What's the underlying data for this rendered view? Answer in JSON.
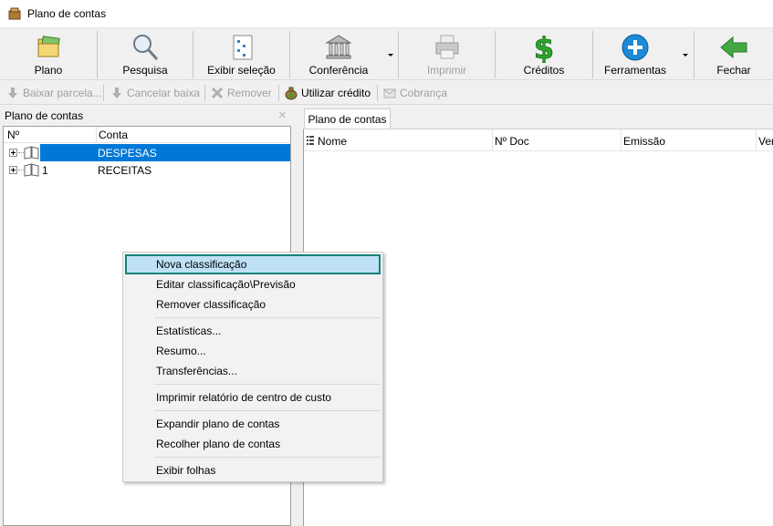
{
  "window": {
    "title": "Plano de contas"
  },
  "toolbar": {
    "buttons": [
      {
        "label": "Plano",
        "icon": "folder-icon",
        "enabled": true
      },
      {
        "label": "Pesquisa",
        "icon": "magnifier-icon",
        "enabled": true
      },
      {
        "label": "Exibir seleção",
        "icon": "document-list-icon",
        "enabled": true
      },
      {
        "label": "Conferência",
        "icon": "bank-icon",
        "enabled": true,
        "dropdown": true
      },
      {
        "label": "Imprimir",
        "icon": "printer-icon",
        "enabled": false
      },
      {
        "label": "Créditos",
        "icon": "dollar-icon",
        "enabled": true
      },
      {
        "label": "Ferramentas",
        "icon": "plus-icon",
        "enabled": true,
        "dropdown": true
      },
      {
        "label": "Fechar",
        "icon": "back-arrow-icon",
        "enabled": true
      }
    ]
  },
  "subtoolbar": {
    "buttons": [
      {
        "label": "Baixar parcela...",
        "icon": "down-arrow-icon",
        "enabled": false
      },
      {
        "label": "Cancelar baixa",
        "icon": "down-arrow-icon",
        "enabled": false
      },
      {
        "label": "Remover",
        "icon": "remove-icon",
        "enabled": false
      },
      {
        "label": "Utilizar crédito",
        "icon": "money-bag-icon",
        "enabled": true
      },
      {
        "label": "Cobrança",
        "icon": "envelope-icon",
        "enabled": false
      }
    ]
  },
  "left_panel": {
    "title": "Plano de contas",
    "columns": [
      "Nº",
      "Conta"
    ],
    "rows": [
      {
        "num": "",
        "name": "DESPESAS",
        "selected": true
      },
      {
        "num": "1",
        "name": "RECEITAS",
        "selected": false
      }
    ]
  },
  "right_panel": {
    "tab": "Plano de contas",
    "columns": [
      "Nome",
      "Nº Doc",
      "Emissão",
      "Ver"
    ]
  },
  "context_menu": {
    "groups": [
      [
        "Nova classificação",
        "Editar classificação\\Previsão",
        "Remover classificação"
      ],
      [
        "Estatísticas...",
        "Resumo...",
        "Transferências..."
      ],
      [
        "Imprimir relatório de centro de custo"
      ],
      [
        "Expandir plano de contas",
        "Recolher plano de contas"
      ],
      [
        "Exibir folhas"
      ]
    ],
    "highlighted": "Nova classificação"
  },
  "colors": {
    "selection": "#0078d7",
    "menu_highlight": "#bfe1f5",
    "menu_highlight_border": "#13827b",
    "credit_green": "#2aa52a",
    "tools_blue": "#1d8ad8",
    "close_green": "#43a843"
  }
}
